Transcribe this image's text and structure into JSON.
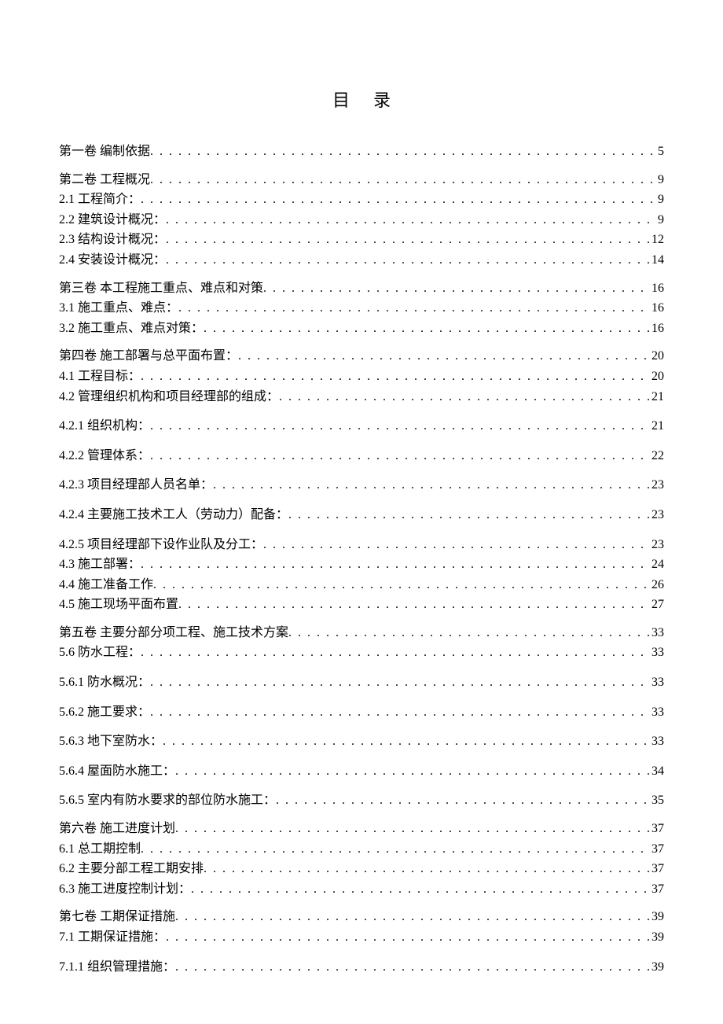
{
  "title": "目录",
  "entries": [
    {
      "type": "vol",
      "label": "第一卷 编制依据",
      "page": "5"
    },
    {
      "type": "vol",
      "label": "第二卷 工程概况",
      "page": "9"
    },
    {
      "type": "sub",
      "label": "2.1 工程简介：",
      "page": "9"
    },
    {
      "type": "sub",
      "label": "2.2 建筑设计概况：",
      "page": "9"
    },
    {
      "type": "sub",
      "label": "2.3 结构设计概况：",
      "page": "12"
    },
    {
      "type": "sub",
      "label": "2.4 安装设计概况：",
      "page": "14"
    },
    {
      "type": "vol",
      "label": "第三卷 本工程施工重点、难点和对策",
      "page": "16"
    },
    {
      "type": "sub",
      "label": "3.1 施工重点、难点：",
      "page": "16"
    },
    {
      "type": "sub",
      "label": "3.2 施工重点、难点对策：",
      "page": "16"
    },
    {
      "type": "vol",
      "label": "第四卷 施工部署与总平面布置：",
      "page": "20"
    },
    {
      "type": "sub",
      "label": "4.1 工程目标：",
      "page": "20"
    },
    {
      "type": "sub",
      "label": "4.2 管理组织机构和项目经理部的组成：",
      "page": "21"
    },
    {
      "type": "subsub",
      "label": "4.2.1 组织机构：",
      "page": "21"
    },
    {
      "type": "subsub",
      "label": "4.2.2 管理体系：",
      "page": "22"
    },
    {
      "type": "subsub",
      "label": "4.2.3  项目经理部人员名单：",
      "page": "23"
    },
    {
      "type": "subsub",
      "label": "4.2.4 主要施工技术工人（劳动力）配备：",
      "page": "23"
    },
    {
      "type": "subsub",
      "label": "4.2.5 项目经理部下设作业队及分工：",
      "page": "23"
    },
    {
      "type": "sub",
      "label": "4.3 施工部署：",
      "page": "24"
    },
    {
      "type": "sub",
      "label": "4.4 施工准备工作",
      "page": "26"
    },
    {
      "type": "sub",
      "label": "4.5 施工现场平面布置",
      "page": "27"
    },
    {
      "type": "vol",
      "label": "第五卷 主要分部分项工程、施工技术方案",
      "page": "33"
    },
    {
      "type": "sub",
      "label": "5.6 防水工程：",
      "page": "33"
    },
    {
      "type": "subsub",
      "label": "5.6.1 防水概况：",
      "page": "33"
    },
    {
      "type": "subsub",
      "label": "5.6.2 施工要求：",
      "page": "33"
    },
    {
      "type": "subsub",
      "label": "5.6.3 地下室防水：",
      "page": "33"
    },
    {
      "type": "subsub",
      "label": "5.6.4 屋面防水施工：",
      "page": "34"
    },
    {
      "type": "subsub",
      "label": "5.6.5 室内有防水要求的部位防水施工：",
      "page": "35"
    },
    {
      "type": "vol",
      "label": "第六卷 施工进度计划",
      "page": "37"
    },
    {
      "type": "sub",
      "label": "6.1 总工期控制",
      "page": "37"
    },
    {
      "type": "sub",
      "label": "6.2 主要分部工程工期安排",
      "page": "37"
    },
    {
      "type": "sub",
      "label": "6.3 施工进度控制计划：",
      "page": "37"
    },
    {
      "type": "vol",
      "label": "第七卷 工期保证措施",
      "page": "39"
    },
    {
      "type": "sub",
      "label": "7.1  工期保证措施：",
      "page": "39"
    },
    {
      "type": "subsub",
      "label": "7.1.1 组织管理措施：",
      "page": "39"
    }
  ]
}
